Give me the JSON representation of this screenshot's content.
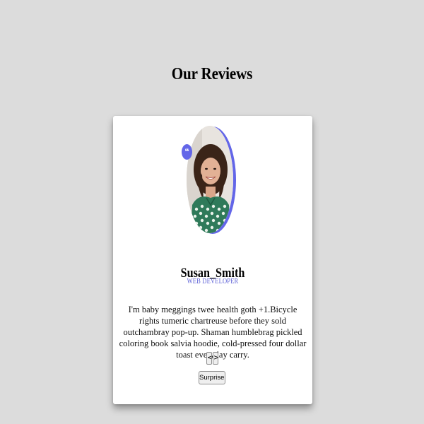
{
  "page": {
    "title": "Our Reviews"
  },
  "review": {
    "author": "Susan_Smith",
    "job": "WEB DEVELOPER",
    "text": "I'm baby meggings twee health goth +1.Bicycle rights tumeric chartreuse before they sold outchambray pop-up. Shaman humblebrag pickled coloring book salvia hoodie, cold-pressed four dollar toast everyday carry.",
    "quote_icon": "quote-icon",
    "image_alt": "Susan_Smith"
  },
  "controls": {
    "prev_label": "<",
    "next_label": ">",
    "surprise_label": "Surprise Me"
  },
  "colors": {
    "accent": "#6366e8",
    "background": "#dcdcdc",
    "card": "#ffffff"
  }
}
